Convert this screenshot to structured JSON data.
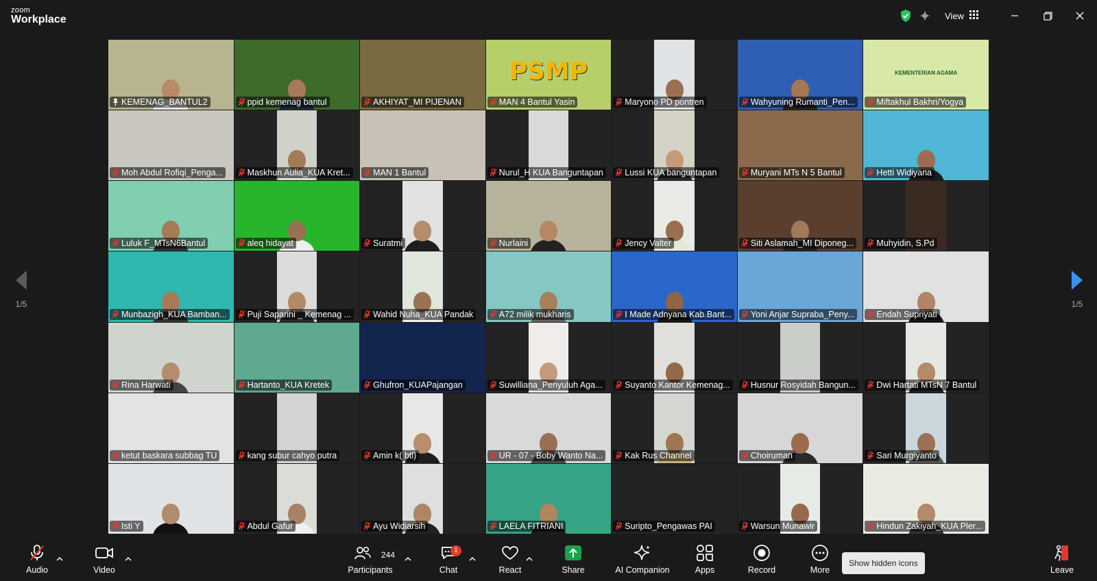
{
  "app": {
    "logo_top": "zoom",
    "logo_bottom": "Workplace"
  },
  "header": {
    "view_label": "View"
  },
  "pagination": {
    "left_label": "1/5",
    "right_label": "1/5"
  },
  "colors": {
    "active_speaker_border": "#2fd15d",
    "muted_mic": "#e5372e",
    "share_green": "#16a34a",
    "next_page_arrow": "#3b8ff2"
  },
  "participants": [
    {
      "name": "KEMENAG_BANTUL2",
      "pinned": true,
      "active": true,
      "bg": "#b7b48f",
      "person": true,
      "skin": "#b98a67",
      "cloth": "#e9e9e2"
    },
    {
      "name": "ppid kemenag bantul",
      "bg": "#3d6b2a",
      "person": true,
      "skin": "#a87a59",
      "cloth": "#1f2a3a"
    },
    {
      "name": "AKHIYAT_MI PIJENAN",
      "bg": "#7a6a3f"
    },
    {
      "name": "MAN 4 Bantul Yasin",
      "bg": "#b6cf6a",
      "banner": "PSMP"
    },
    {
      "name": "Maryono PD pontren",
      "bg": "#dfe3e8",
      "narrow": true,
      "person": true,
      "skin": "#9b7053",
      "cloth": "#e6e6e6"
    },
    {
      "name": "Wahyuning Rumanti_Pen...",
      "bg": "#2f5fb5",
      "person": true,
      "skin": "#a57755",
      "cloth": "#222222"
    },
    {
      "name": "Miftakhul Bakhri/Yogya",
      "bg": "#d8e8a6",
      "banner_small": "KEMENTERIAN AGAMA"
    },
    {
      "name": "Moh Abdul Rofiqi_Penga...",
      "bg": "#c9c6bd"
    },
    {
      "name": "Maskhun Aulia_KUA Kret...",
      "bg": "#cfd2c8",
      "narrow": true,
      "person": true,
      "skin": "#a57a58",
      "cloth": "#dfe3d6"
    },
    {
      "name": "MAN 1 Bantul",
      "bg": "#c7c2b5"
    },
    {
      "name": "Nurul_H KUA Banguntapan",
      "bg": "#d9d9d9",
      "narrow": true
    },
    {
      "name": "Lussi KUA banguntapan",
      "bg": "#d7d2c8",
      "narrow": true,
      "person": true,
      "skin": "#c49a78",
      "cloth": "#2a2a2a"
    },
    {
      "name": "Muryani MTs N 5 Bantul",
      "bg": "#8a6a4a"
    },
    {
      "name": "Hetti Widiyana",
      "bg": "#4fb6d6",
      "person": true,
      "skin": "#9b6e50",
      "cloth": "#1b1b1b"
    },
    {
      "name": "Luluk F_MTsN6Bantul",
      "bg": "#7fcfb0",
      "person": true,
      "skin": "#a77a58",
      "cloth": "#333333"
    },
    {
      "name": "aleq hidayat",
      "bg": "#27b52b",
      "person": true,
      "skin": "#9a7054",
      "cloth": "#f0f0f0"
    },
    {
      "name": "Suratmi",
      "bg": "#e2e2e2",
      "narrow": true,
      "person": true,
      "skin": "#b58c6c",
      "cloth": "#1e1e1e"
    },
    {
      "name": "Nurlaini",
      "bg": "#b8b39c",
      "person": true,
      "skin": "#b48862",
      "cloth": "#222222"
    },
    {
      "name": "Jency Valter",
      "bg": "#e9ebe6",
      "narrow": true,
      "person": true,
      "skin": "#9c6f4f",
      "cloth": "#e4e8dc"
    },
    {
      "name": "Siti Aslamah_MI Diponeg...",
      "bg": "#5a3f30",
      "person": true,
      "skin": "#a27a5c",
      "cloth": "#222"
    },
    {
      "name": "Muhyidin, S.Pd",
      "bg": "#3a2a20",
      "narrow": true
    },
    {
      "name": "Munbazigh_KUA Bamban...",
      "bg": "#2fb7b0",
      "person": true,
      "skin": "#a77a57",
      "cloth": "#333333"
    },
    {
      "name": "Puji Saparini _ Kemenag ...",
      "bg": "#dcdcdc",
      "narrow": true,
      "person": true,
      "skin": "#b38a69",
      "cloth": "#2c2c2c"
    },
    {
      "name": "Wahid Nuha_KUA Pandak",
      "bg": "#dfe6dc",
      "narrow": true,
      "person": true,
      "skin": "#9d7254",
      "cloth": "#f1f1f1"
    },
    {
      "name": "A72 milik mukharis",
      "bg": "#86c7c3",
      "person": true,
      "skin": "#a7805f",
      "cloth": "#666666"
    },
    {
      "name": "I Made Adnyana Kab.Bant...",
      "bg": "#2b66c9",
      "person": true,
      "skin": "#8f6547",
      "cloth": "#151515"
    },
    {
      "name": "Yoni Anjar Supraba_Peny...",
      "bg": "#6aa6d8"
    },
    {
      "name": "Endah Supriyati",
      "bg": "#e1e1e1",
      "person": true,
      "skin": "#b08466",
      "cloth": "#151515"
    },
    {
      "name": "Rina Harwati",
      "bg": "#cfd5cc",
      "person": true,
      "skin": "#b48c70",
      "cloth": "#444444"
    },
    {
      "name": "Hartanto_KUA Kretek",
      "bg": "#5fa98f"
    },
    {
      "name": "Ghufron_KUAPajangan",
      "bg": "#13254e"
    },
    {
      "name": "Suwilliana_Penyuluh Aga...",
      "bg": "#f0ecea",
      "narrow": true,
      "person": true,
      "skin": "#c59b7d",
      "cloth": "#e9e3e0"
    },
    {
      "name": "Suyanto Kantor Kemenag...",
      "bg": "#dfe0dc",
      "narrow": true,
      "person": true,
      "skin": "#93694b",
      "cloth": "#e6e6e6"
    },
    {
      "name": "Husnur Rosyidah Bangun...",
      "bg": "#c9cec9",
      "narrow": true
    },
    {
      "name": "Dwi Hartati MTsN 7 Bantul",
      "bg": "#e6e6e2",
      "narrow": true,
      "person": true,
      "skin": "#b48b6a",
      "cloth": "#202020"
    },
    {
      "name": "ketut baskara subbag TU",
      "bg": "#e3e3e3"
    },
    {
      "name": "kang subur cahyo putra",
      "bg": "#d3d3d3",
      "narrow": true
    },
    {
      "name": "Amin k( btl)",
      "bg": "#e7e7e7",
      "narrow": true,
      "person": true,
      "skin": "#b88e6d",
      "cloth": "#1f1f1f"
    },
    {
      "name": "UR - 07 - Boby Wanto Na...",
      "bg": "#d9d9d9",
      "person": true,
      "skin": "#9a7055",
      "cloth": "#4a4a4a"
    },
    {
      "name": "Kak Rus Channel",
      "bg": "#d4d7cf",
      "narrow": true,
      "person": true,
      "skin": "#a17653",
      "cloth": "#c9b37a"
    },
    {
      "name": "Choiruman",
      "bg": "#d7d7d7",
      "person": true,
      "skin": "#9b6c4c",
      "cloth": "#2a2a2a"
    },
    {
      "name": "Sari Murgiyanto",
      "bg": "#cbd7dd",
      "narrow": true,
      "person": true,
      "skin": "#9b7256",
      "cloth": "#555555"
    },
    {
      "name": "Isti Y",
      "bg": "#dfe3e6",
      "person": true,
      "skin": "#b28a6c",
      "cloth": "#111111"
    },
    {
      "name": "Abdul Gafur",
      "bg": "#dadcd6",
      "narrow": true,
      "person": true,
      "skin": "#a88264",
      "cloth": "#f0f0f0"
    },
    {
      "name": "Ayu Widiarsih",
      "bg": "#dde0dc",
      "narrow": true,
      "person": true,
      "skin": "#b08566",
      "cloth": "#222222"
    },
    {
      "name": "LAELA FITRIANI",
      "bg": "#36a486",
      "person": true,
      "skin": "#b08562",
      "cloth": "#1c1c1c"
    },
    {
      "name": "Suripto_Pengawas PAI",
      "bg": "#232323",
      "novideo": true
    },
    {
      "name": "Warsun Munawir",
      "bg": "#e7ebe6",
      "narrow": true,
      "person": true,
      "skin": "#97694b",
      "cloth": "#eeeeee"
    },
    {
      "name": "Hindun Zakiyah_KUA Pler...",
      "bg": "#e9ede1",
      "person": true,
      "skin": "#b38a6a",
      "cloth": "#333333"
    }
  ],
  "toolbar": {
    "audio_label": "Audio",
    "video_label": "Video",
    "participants_label": "Participants",
    "participants_count": "244",
    "chat_label": "Chat",
    "chat_badge": "1",
    "react_label": "React",
    "share_label": "Share",
    "ai_label": "AI Companion",
    "apps_label": "Apps",
    "record_label": "Record",
    "more_label": "More",
    "hidden_icons_label": "Show hidden icons",
    "leave_label": "Leave"
  }
}
